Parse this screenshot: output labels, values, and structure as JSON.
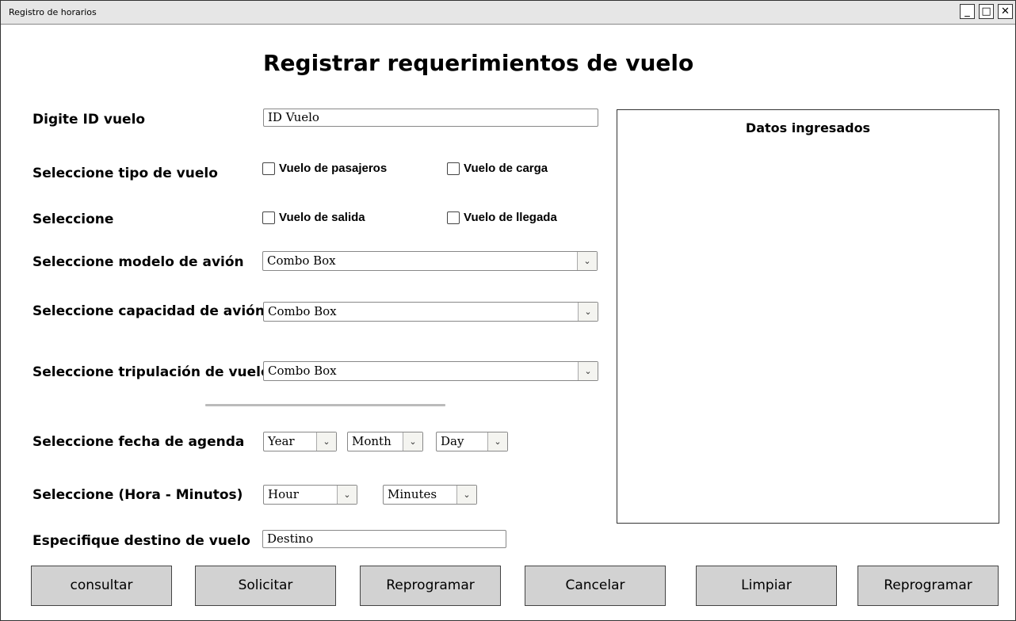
{
  "window": {
    "title": "Registro de horarios",
    "controls": {
      "minimize": "_",
      "maximize": "□",
      "close": "✕"
    }
  },
  "form": {
    "heading": "Registrar requerimientos de vuelo",
    "flight_id": {
      "label": "Digite ID vuelo",
      "value": "ID Vuelo"
    },
    "flight_type": {
      "label": "Seleccione tipo de vuelo",
      "options": [
        {
          "label": "Vuelo de pasajeros",
          "checked": false
        },
        {
          "label": "Vuelo de carga",
          "checked": false
        }
      ]
    },
    "direction": {
      "label": "Seleccione",
      "options": [
        {
          "label": "Vuelo de salida",
          "checked": false
        },
        {
          "label": "Vuelo de llegada",
          "checked": false
        }
      ]
    },
    "aircraft_model": {
      "label": "Seleccione modelo de avión",
      "value": "Combo Box"
    },
    "aircraft_capacity": {
      "label": "Seleccione capacidad de avión",
      "value": "Combo Box"
    },
    "crew": {
      "label": "Seleccione tripulación de vuelo",
      "value": "Combo Box"
    },
    "schedule_date": {
      "label": "Seleccione fecha de agenda",
      "year": "Year",
      "month": "Month",
      "day": "Day"
    },
    "schedule_time": {
      "label": "Seleccione (Hora - Minutos)",
      "hour": "Hour",
      "minutes": "Minutes"
    },
    "destination": {
      "label": "Especifique destino de vuelo",
      "value": "Destino"
    }
  },
  "panel": {
    "title": "Datos ingresados"
  },
  "buttons": {
    "consultar": "consultar",
    "solicitar": "Solicitar",
    "reprogramar1": "Reprogramar",
    "cancelar": "Cancelar",
    "limpiar": "Limpiar",
    "reprogramar2": "Reprogramar"
  },
  "icons": {
    "dropdown_arrow": "chevron-down-icon",
    "arrow_glyph": "⌄"
  }
}
